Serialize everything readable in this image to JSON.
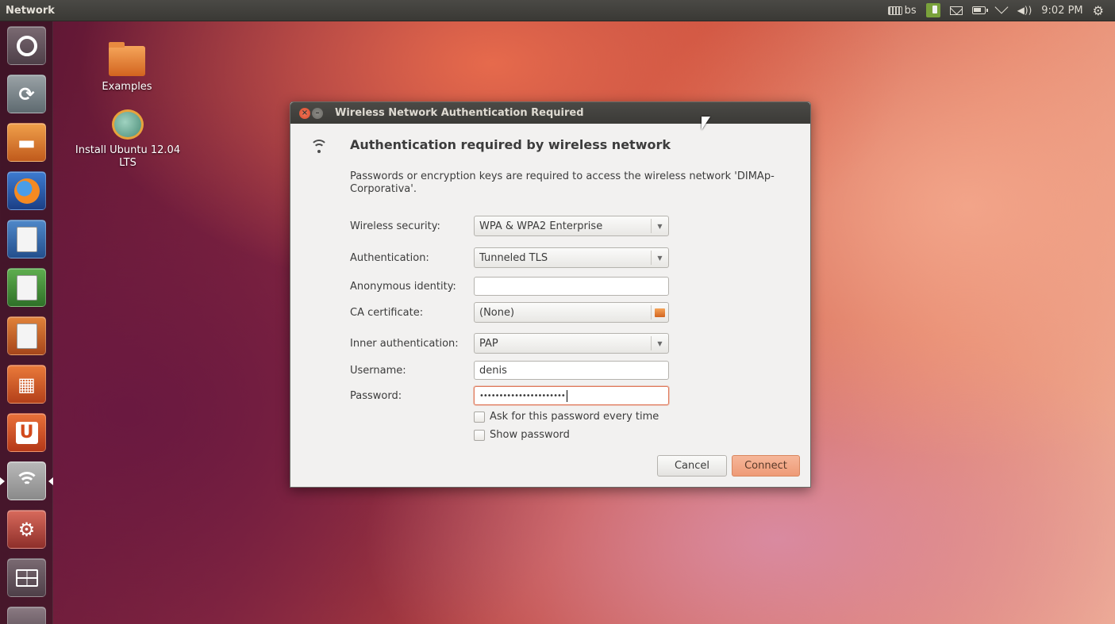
{
  "top_panel": {
    "title": "Network",
    "keyboard_layout": "bs",
    "clock": "9:02 PM",
    "icons": [
      "keyboard-icon",
      "gesture-app-icon",
      "mail-icon",
      "battery-icon",
      "wifi-indicator-icon",
      "volume-icon",
      "session-gear-icon"
    ]
  },
  "launcher": {
    "items": [
      {
        "name": "dash-home",
        "icon": "ubuntu-logo-icon"
      },
      {
        "name": "install-ubuntu",
        "icon": "installer-icon"
      },
      {
        "name": "files",
        "icon": "folder-icon"
      },
      {
        "name": "firefox",
        "icon": "firefox-icon"
      },
      {
        "name": "libreoffice-writer",
        "icon": "writer-icon"
      },
      {
        "name": "libreoffice-calc",
        "icon": "calc-icon"
      },
      {
        "name": "libreoffice-impress",
        "icon": "impress-icon"
      },
      {
        "name": "software-center",
        "icon": "shopping-bag-icon"
      },
      {
        "name": "ubuntu-one",
        "icon": "ubuntu-one-icon",
        "glyph": "U"
      },
      {
        "name": "network",
        "icon": "wifi-icon",
        "active": true
      },
      {
        "name": "system-settings",
        "icon": "settings-icon"
      },
      {
        "name": "workspace-switcher",
        "icon": "workspace-icon"
      },
      {
        "name": "trash",
        "icon": "trash-icon"
      }
    ]
  },
  "desktop": {
    "icons": [
      {
        "label": "Examples",
        "icon": "folder-icon"
      },
      {
        "label": "Install Ubuntu 12.04 LTS",
        "icon": "installer-icon"
      }
    ]
  },
  "dialog": {
    "title": "Wireless Network Authentication Required",
    "heading": "Authentication required by wireless network",
    "description": "Passwords or encryption keys are required to access the wireless network 'DIMAp-Corporativa'.",
    "fields": {
      "wireless_security": {
        "label": "Wireless security:",
        "value": "WPA & WPA2 Enterprise"
      },
      "authentication": {
        "label": "Authentication:",
        "value": "Tunneled TLS"
      },
      "anonymous_identity": {
        "label": "Anonymous identity:",
        "value": ""
      },
      "ca_certificate": {
        "label": "CA certificate:",
        "value": "(None)"
      },
      "inner_authentication": {
        "label": "Inner authentication:",
        "value": "PAP"
      },
      "username": {
        "label": "Username:",
        "value": "denis"
      },
      "password": {
        "label": "Password:",
        "value": "••••••••••••••••••••••"
      }
    },
    "checkboxes": {
      "ask_every_time": {
        "label": "Ask for this password every time",
        "checked": false
      },
      "show_password": {
        "label": "Show password",
        "checked": false
      }
    },
    "buttons": {
      "cancel": "Cancel",
      "connect": "Connect"
    }
  },
  "colors": {
    "panel_bg": "#3b3a37",
    "accent_orange": "#ee9a76",
    "dialog_bg": "#f2f1f0"
  }
}
